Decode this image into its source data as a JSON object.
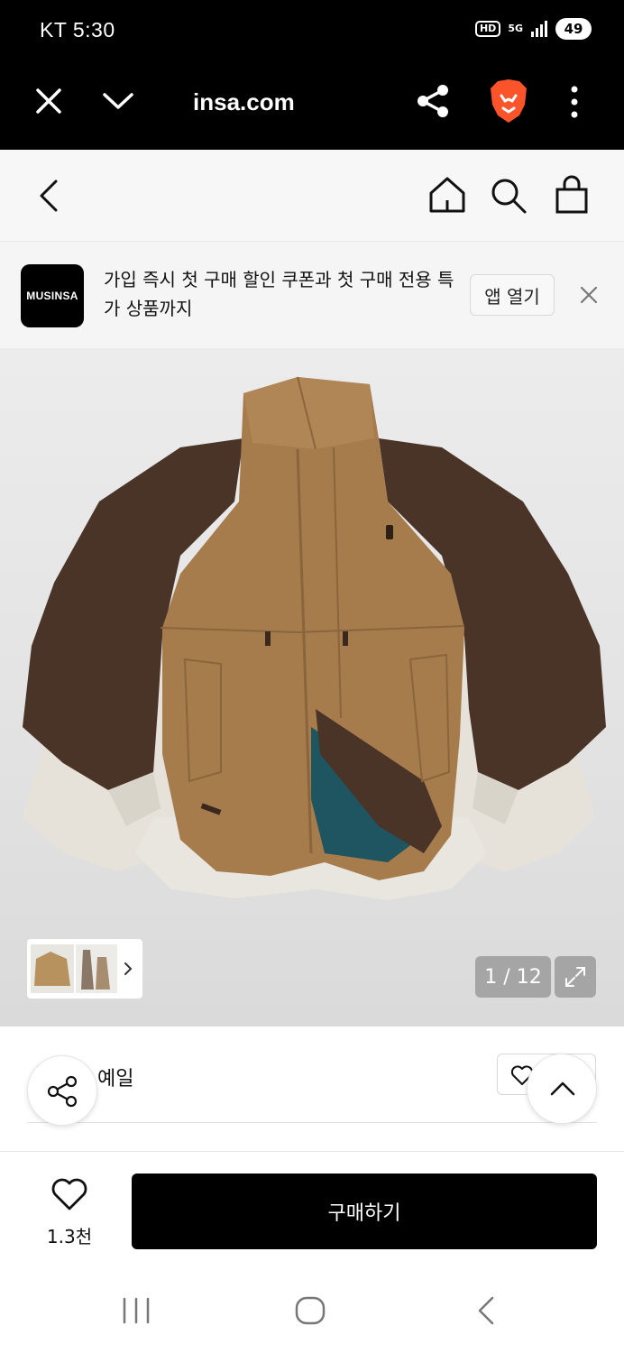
{
  "status_bar": {
    "carrier_time": "KT 5:30",
    "hd": "HD",
    "network": "5G",
    "battery": "49"
  },
  "browser": {
    "url": "insa.com"
  },
  "site_header": {
    "back": "back",
    "home": "home",
    "search": "search",
    "cart": "cart"
  },
  "banner": {
    "logo_text": "MUSINSA",
    "message": "가입 즉시 첫 구매 할인 쿠폰과 첫 구매 전용 특가 상품까지",
    "open_app_label": "앱 열기"
  },
  "gallery": {
    "counter": "1 / 12"
  },
  "brand": {
    "name": "예일"
  },
  "purchase": {
    "like_count": "1.3천",
    "buy_label": "구매하기"
  },
  "colors": {
    "accent": "#000000",
    "jacket_tan": "#a67c4c",
    "jacket_brown": "#4a3327",
    "jacket_cream": "#e6e2da",
    "lining_teal": "#1f5560"
  }
}
